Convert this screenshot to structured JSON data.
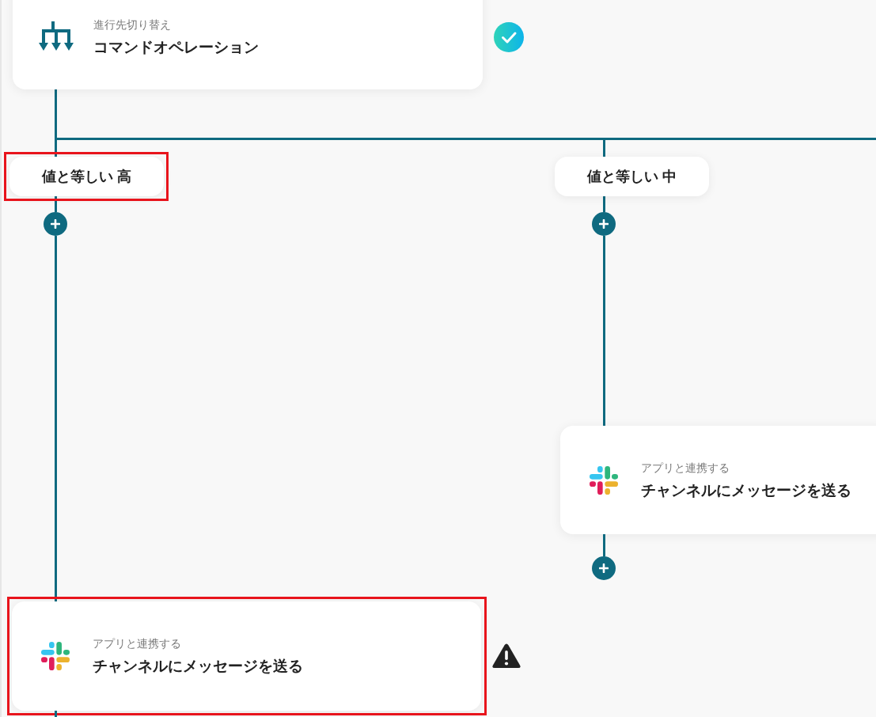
{
  "switch_step": {
    "category": "進行先切り替え",
    "title": "コマンドオペレーション",
    "complete": true
  },
  "branches": [
    {
      "condition": "値と等しい 高",
      "highlighted": true,
      "steps": [
        {
          "category": "アプリと連携する",
          "title": "チャンネルにメッセージを送る",
          "warning": true,
          "highlighted": true
        }
      ]
    },
    {
      "condition": "値と等しい 中",
      "highlighted": false,
      "steps": [
        {
          "category": "アプリと連携する",
          "title": "チャンネルにメッセージを送る",
          "highlighted": false
        }
      ]
    }
  ]
}
